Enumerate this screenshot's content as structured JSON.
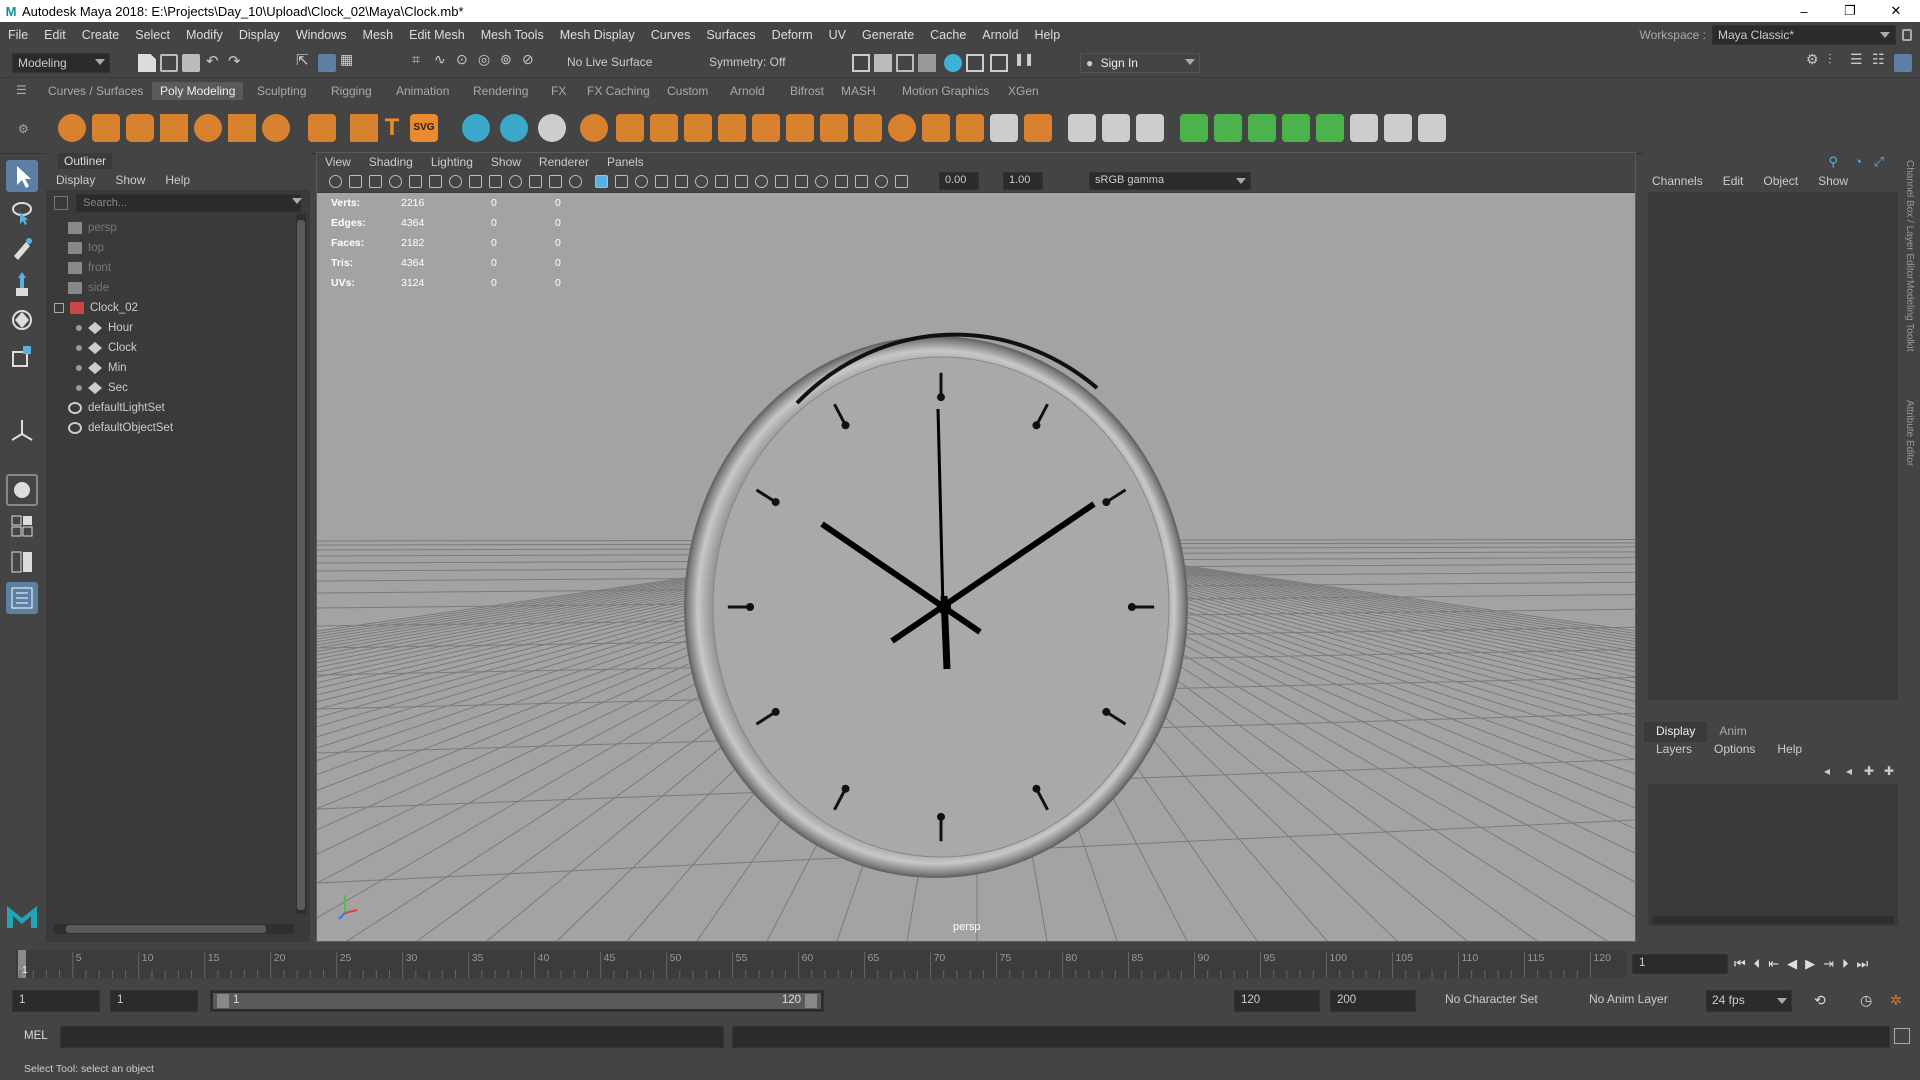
{
  "window": {
    "title": "Autodesk Maya 2018: E:\\Projects\\Day_10\\Upload\\Clock_02\\Maya\\Clock.mb*",
    "logo": "M",
    "min": "–",
    "max": "❐",
    "close": "✕"
  },
  "menubar": {
    "items": [
      "File",
      "Edit",
      "Create",
      "Select",
      "Modify",
      "Display",
      "Windows",
      "Mesh",
      "Edit Mesh",
      "Mesh Tools",
      "Mesh Display",
      "Curves",
      "Surfaces",
      "Deform",
      "UV",
      "Generate",
      "Cache",
      "Arnold",
      "Help"
    ],
    "workspace_label": "Workspace :",
    "workspace_value": "Maya Classic*"
  },
  "toolbar": {
    "mode": "Modeling",
    "live_surface": "No Live Surface",
    "symmetry": "Symmetry: Off",
    "sign_in": "Sign In"
  },
  "shelf": {
    "tabs": [
      "Curves / Surfaces",
      "Poly Modeling",
      "Sculpting",
      "Rigging",
      "Animation",
      "Rendering",
      "FX",
      "FX Caching",
      "Custom",
      "Arnold",
      "Bifrost",
      "MASH",
      "Motion Graphics",
      "XGen"
    ],
    "active_tab": "Poly Modeling",
    "svg_label": "SVG",
    "text_label": "T"
  },
  "outliner": {
    "title": "Outliner",
    "menu": [
      "Display",
      "Show",
      "Help"
    ],
    "search_placeholder": "Search...",
    "items": [
      {
        "label": "persp",
        "dim": true,
        "indent": 0
      },
      {
        "label": "top",
        "dim": true,
        "indent": 0
      },
      {
        "label": "front",
        "dim": true,
        "indent": 0
      },
      {
        "label": "side",
        "dim": true,
        "indent": 0
      },
      {
        "label": "Clock_02",
        "dim": false,
        "indent": 0
      },
      {
        "label": "Hour",
        "dim": false,
        "indent": 1
      },
      {
        "label": "Clock",
        "dim": false,
        "indent": 1
      },
      {
        "label": "Min",
        "dim": false,
        "indent": 1
      },
      {
        "label": "Sec",
        "dim": false,
        "indent": 1
      },
      {
        "label": "defaultLightSet",
        "dim": false,
        "indent": 0
      },
      {
        "label": "defaultObjectSet",
        "dim": false,
        "indent": 0
      }
    ]
  },
  "viewport": {
    "menu": [
      "View",
      "Shading",
      "Lighting",
      "Show",
      "Renderer",
      "Panels"
    ],
    "near": "0.00",
    "far": "1.00",
    "color_space": "sRGB gamma",
    "camera": "persp",
    "hud": [
      {
        "k": "Verts:",
        "v": "2216",
        "a": "0",
        "b": "0"
      },
      {
        "k": "Edges:",
        "v": "4364",
        "a": "0",
        "b": "0"
      },
      {
        "k": "Faces:",
        "v": "2182",
        "a": "0",
        "b": "0"
      },
      {
        "k": "Tris:",
        "v": "4364",
        "a": "0",
        "b": "0"
      },
      {
        "k": "UVs:",
        "v": "3124",
        "a": "0",
        "b": "0"
      }
    ]
  },
  "channelbox": {
    "menu": [
      "Channels",
      "Edit",
      "Object",
      "Show"
    ],
    "layer_tabs": [
      "Display",
      "Anim"
    ],
    "layer_menu": [
      "Layers",
      "Options",
      "Help"
    ],
    "vertical_tabs": [
      "Channel Box / Layer Editor",
      "Modeling Toolkit",
      "Attribute Editor"
    ]
  },
  "timeslider": {
    "ticks": [
      "5",
      "10",
      "15",
      "20",
      "25",
      "30",
      "35",
      "40",
      "45",
      "50",
      "55",
      "60",
      "65",
      "70",
      "75",
      "80",
      "85",
      "90",
      "95",
      "100",
      "105",
      "110",
      "115",
      "120"
    ],
    "start_marker": "1",
    "current_frame": "1"
  },
  "range": {
    "start": "1",
    "anim_start": "1",
    "slider_start": "1",
    "slider_end": "120",
    "end": "120",
    "anim_end": "200",
    "character_set": "No Character Set",
    "anim_layer": "No Anim Layer",
    "fps": "24 fps"
  },
  "cmdline": {
    "lang": "MEL"
  },
  "helpline": {
    "text": "Select Tool: select an object"
  }
}
